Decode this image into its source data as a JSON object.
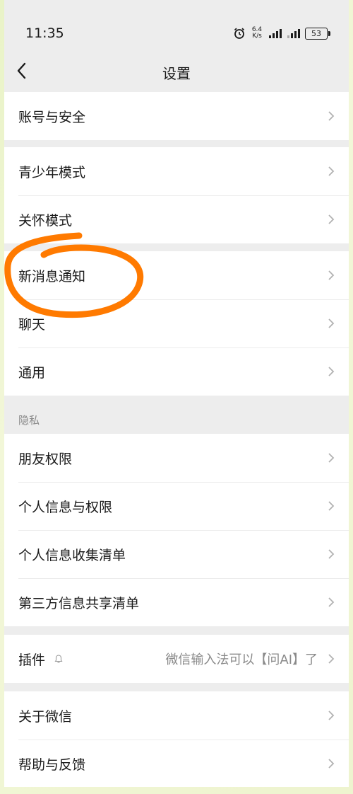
{
  "status_bar": {
    "time": "11:35",
    "net_speed_value": "6.4",
    "net_speed_unit": "K/s",
    "battery": "53"
  },
  "nav": {
    "title": "设置"
  },
  "groups": {
    "account": {
      "items": [
        {
          "label": "账号与安全"
        }
      ]
    },
    "modes": {
      "items": [
        {
          "label": "青少年模式"
        },
        {
          "label": "关怀模式"
        }
      ]
    },
    "general": {
      "items": [
        {
          "label": "新消息通知"
        },
        {
          "label": "聊天"
        },
        {
          "label": "通用"
        }
      ]
    },
    "privacy": {
      "header": "隐私",
      "items": [
        {
          "label": "朋友权限"
        },
        {
          "label": "个人信息与权限"
        },
        {
          "label": "个人信息收集清单"
        },
        {
          "label": "第三方信息共享清单"
        }
      ]
    },
    "plugins": {
      "items": [
        {
          "label": "插件",
          "value": "微信输入法可以【问AI】了"
        }
      ]
    },
    "about": {
      "items": [
        {
          "label": "关于微信"
        },
        {
          "label": "帮助与反馈"
        }
      ]
    }
  },
  "colors": {
    "annotation": "#ff7a00",
    "background": "#ededed",
    "card": "#ffffff"
  }
}
